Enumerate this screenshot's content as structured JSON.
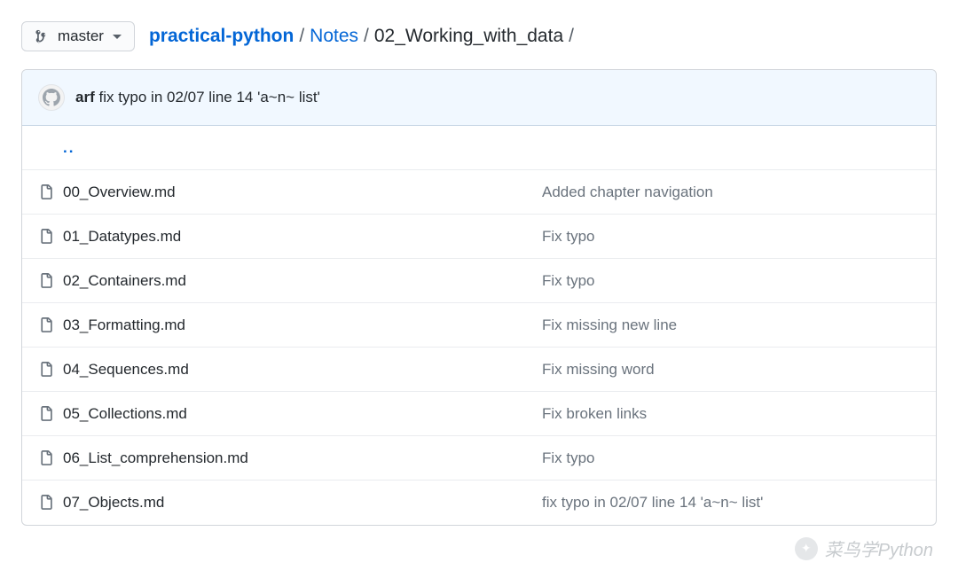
{
  "branch": {
    "name": "master"
  },
  "breadcrumb": {
    "repo": "practical-python",
    "parts": [
      "Notes",
      "02_Working_with_data"
    ]
  },
  "latest_commit": {
    "author": "arf",
    "message": "fix typo in 02/07 line 14 'a~n~ list'"
  },
  "up_dir": {
    "label": ".."
  },
  "files": [
    {
      "name": "00_Overview.md",
      "commit_message": "Added chapter navigation"
    },
    {
      "name": "01_Datatypes.md",
      "commit_message": "Fix typo"
    },
    {
      "name": "02_Containers.md",
      "commit_message": "Fix typo"
    },
    {
      "name": "03_Formatting.md",
      "commit_message": "Fix missing new line"
    },
    {
      "name": "04_Sequences.md",
      "commit_message": "Fix missing word"
    },
    {
      "name": "05_Collections.md",
      "commit_message": "Fix broken links"
    },
    {
      "name": "06_List_comprehension.md",
      "commit_message": "Fix typo"
    },
    {
      "name": "07_Objects.md",
      "commit_message": "fix typo in 02/07 line 14 'a~n~ list'"
    }
  ],
  "watermark": {
    "text": "菜鸟学Python"
  }
}
